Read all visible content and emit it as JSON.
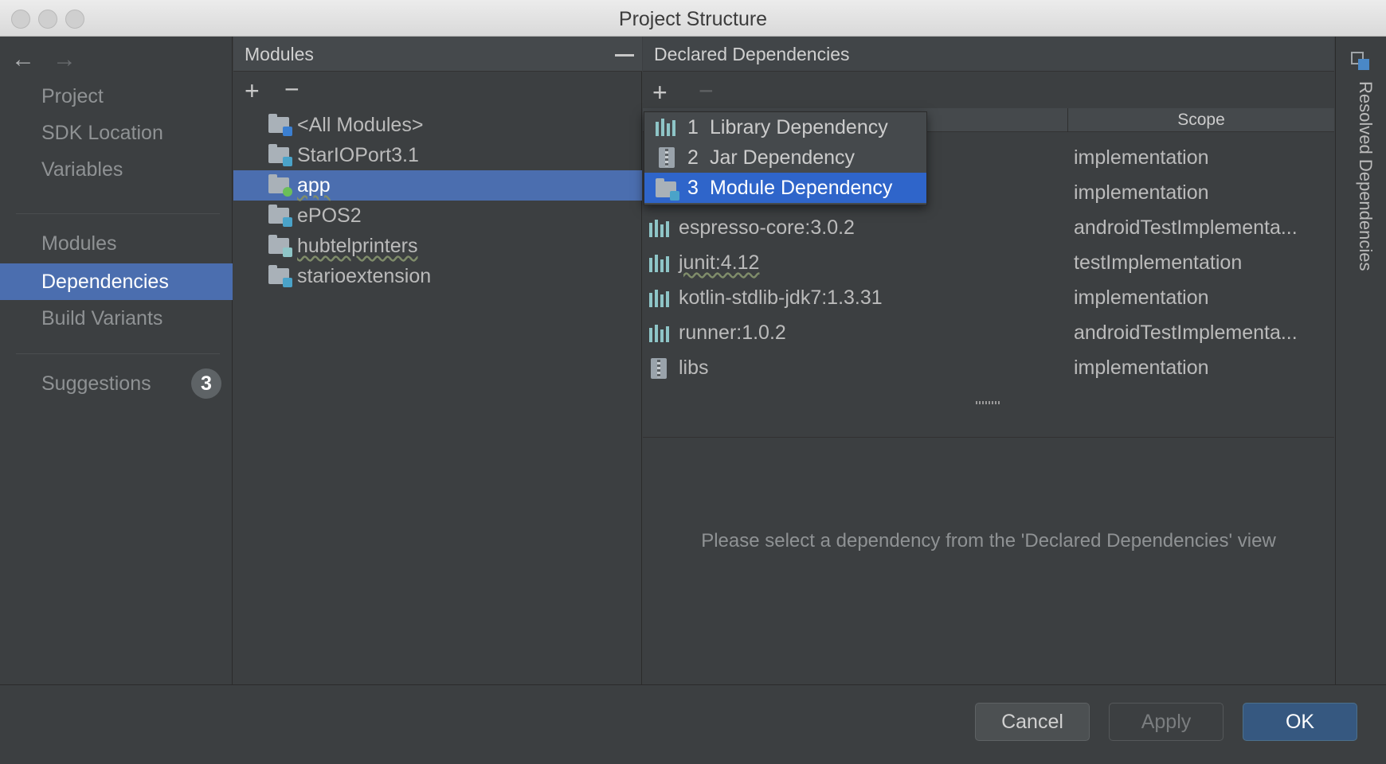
{
  "window": {
    "title": "Project Structure"
  },
  "nav": {
    "back_icon": "arrow-left-icon",
    "forward_icon": "arrow-right-icon"
  },
  "sidebar": {
    "items": [
      {
        "label": "Project"
      },
      {
        "label": "SDK Location"
      },
      {
        "label": "Variables"
      },
      {
        "label": "Modules"
      },
      {
        "label": "Dependencies",
        "selected": true
      },
      {
        "label": "Build Variants"
      },
      {
        "label": "Suggestions",
        "badge": "3"
      }
    ]
  },
  "modules": {
    "header": "Modules",
    "items": [
      {
        "label": "<All Modules>"
      },
      {
        "label": "StarIOPort3.1"
      },
      {
        "label": "app",
        "selected": true
      },
      {
        "label": "ePOS2"
      },
      {
        "label": "hubtelprinters"
      },
      {
        "label": "starioextension"
      }
    ]
  },
  "declared": {
    "header": "Declared Dependencies",
    "scope_header": "Scope",
    "rows": [
      {
        "name": "",
        "scope": "implementation"
      },
      {
        "name": "",
        "scope": "implementation"
      },
      {
        "name": "espresso-core:3.0.2",
        "scope": "androidTestImplementa..."
      },
      {
        "name": "junit:4.12",
        "scope": "testImplementation"
      },
      {
        "name": "kotlin-stdlib-jdk7:1.3.31",
        "scope": "implementation"
      },
      {
        "name": "runner:1.0.2",
        "scope": "androidTestImplementa..."
      },
      {
        "name": "libs",
        "scope": "implementation"
      }
    ],
    "empty_message": "Please select a dependency from the 'Declared Dependencies' view"
  },
  "popup": {
    "items": [
      {
        "num": "1",
        "label": "Library Dependency"
      },
      {
        "num": "2",
        "label": "Jar Dependency"
      },
      {
        "num": "3",
        "label": "Module Dependency",
        "selected": true
      }
    ]
  },
  "right_strip": {
    "label": "Resolved Dependencies"
  },
  "footer": {
    "cancel": "Cancel",
    "apply": "Apply",
    "ok": "OK"
  },
  "colors": {
    "selection": "#4b6eaf",
    "menu_selection": "#2f65ca",
    "library_bars": "#8ec5c7"
  }
}
